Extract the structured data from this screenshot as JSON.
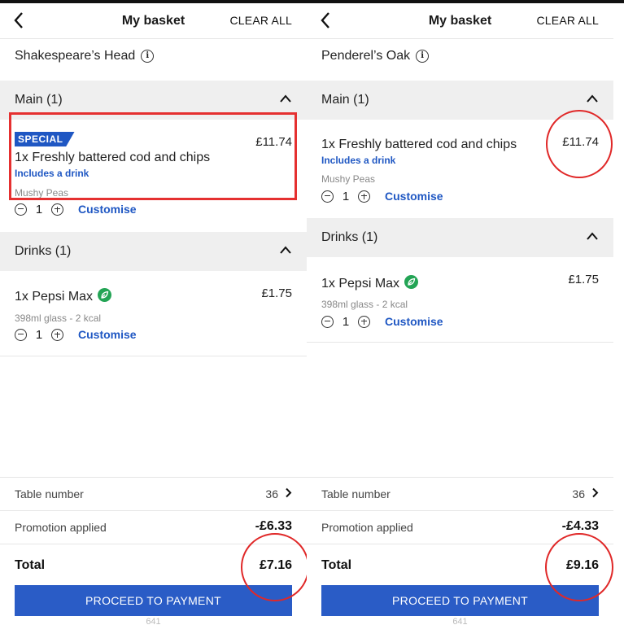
{
  "colors": {
    "accent": "#1f57c3",
    "button": "#2a5cc6",
    "highlight": "#e02828",
    "leaf": "#23a455"
  },
  "panels": [
    {
      "header": {
        "title": "My basket",
        "clear_label": "CLEAR ALL"
      },
      "venue": "Shakespeare’s Head",
      "main_section": "Main (1)",
      "main_item": {
        "badge": "SPECIAL",
        "name": "1x Freshly battered cod and chips",
        "price": "£11.74",
        "promo_note": "Includes a drink",
        "side": "Mushy Peas",
        "qty": "1",
        "customise": "Customise"
      },
      "drinks_section": "Drinks (1)",
      "drink_item": {
        "name": "1x Pepsi Max",
        "price": "£1.75",
        "detail": "398ml glass - 2 kcal",
        "qty": "1",
        "customise": "Customise"
      },
      "footer": {
        "table_label": "Table number",
        "table_value": "36",
        "promo_label": "Promotion applied",
        "promo_value": "-£6.33",
        "total_label": "Total",
        "total_value": "£7.16",
        "pay_label": "PROCEED TO PAYMENT",
        "under_text": "641"
      }
    },
    {
      "header": {
        "title": "My basket",
        "clear_label": "CLEAR ALL"
      },
      "venue": "Penderel’s Oak",
      "main_section": "Main (1)",
      "main_item": {
        "name": "1x Freshly battered cod and chips",
        "price": "£11.74",
        "promo_note": "Includes a drink",
        "side": "Mushy Peas",
        "qty": "1",
        "customise": "Customise"
      },
      "drinks_section": "Drinks (1)",
      "drink_item": {
        "name": "1x Pepsi Max",
        "price": "£1.75",
        "detail": "398ml glass - 2 kcal",
        "qty": "1",
        "customise": "Customise"
      },
      "footer": {
        "table_label": "Table number",
        "table_value": "36",
        "promo_label": "Promotion applied",
        "promo_value": "-£4.33",
        "total_label": "Total",
        "total_value": "£9.16",
        "pay_label": "PROCEED TO PAYMENT",
        "under_text": "641"
      }
    }
  ]
}
